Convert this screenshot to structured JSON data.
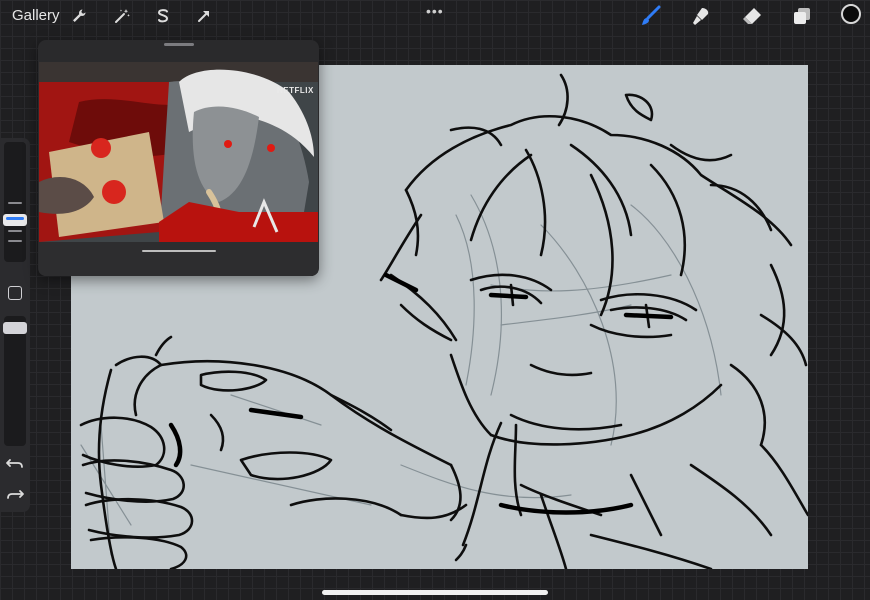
{
  "toolbar": {
    "gallery_label": "Gallery",
    "actions_icon": "wrench-icon",
    "adjustments_icon": "magic-wand-icon",
    "selection_icon": "selection-s-icon",
    "transform_icon": "transform-arrow-icon",
    "more_label": "•••",
    "brush_icon": "brush-icon",
    "smudge_icon": "smudge-icon",
    "eraser_icon": "eraser-icon",
    "layers_icon": "layers-icon",
    "current_color": "#0b0b0b",
    "accent_color": "#2f7cf6"
  },
  "sidebar": {
    "undo_icon": "undo-icon",
    "redo_icon": "redo-icon",
    "modify_icon": "square-modify-icon"
  },
  "reference": {
    "watermark": "NETFLIX"
  }
}
